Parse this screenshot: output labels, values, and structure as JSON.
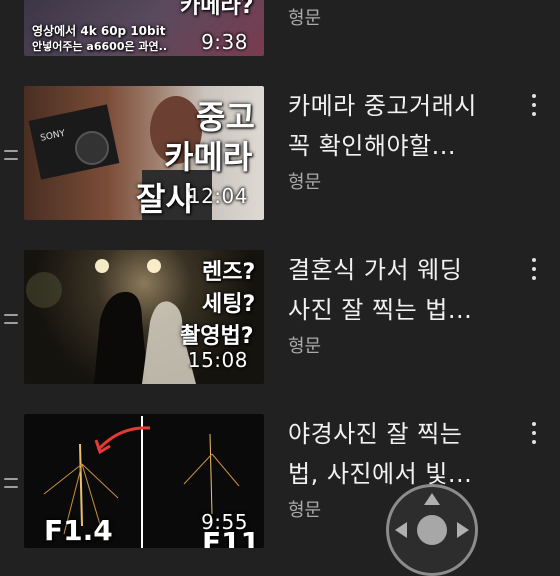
{
  "videos": [
    {
      "title": "",
      "channel": "형문",
      "duration": "9:38",
      "overlay_lines": [
        "카메라?",
        "영상에서 4k 60p 10bit",
        "안넣어주는 a6600은 과연.."
      ]
    },
    {
      "title": "카메라 중고거래시\n꼭 확인해야할...",
      "channel": "형문",
      "duration": "12:04",
      "overlay_lines": [
        "중고",
        "카메라",
        "잘사"
      ]
    },
    {
      "title": "결혼식 가서 웨딩\n사진 잘 찍는 법...",
      "channel": "형문",
      "duration": "15:08",
      "overlay_lines": [
        "렌즈?",
        "세팅?",
        "촬영법?"
      ]
    },
    {
      "title": "야경사진 잘 찍는\n법, 사진에서 빛...",
      "channel": "형문",
      "duration": "9:55",
      "overlay_lines": [
        "F1.4",
        "F11"
      ]
    }
  ],
  "icons": {
    "drag_handle": "drag-handle-icon",
    "more": "more-vert-icon",
    "dpad": "dpad-icon"
  },
  "colors": {
    "background": "#212121",
    "title": "#f1f1f1",
    "channel": "#aaaaaa"
  }
}
